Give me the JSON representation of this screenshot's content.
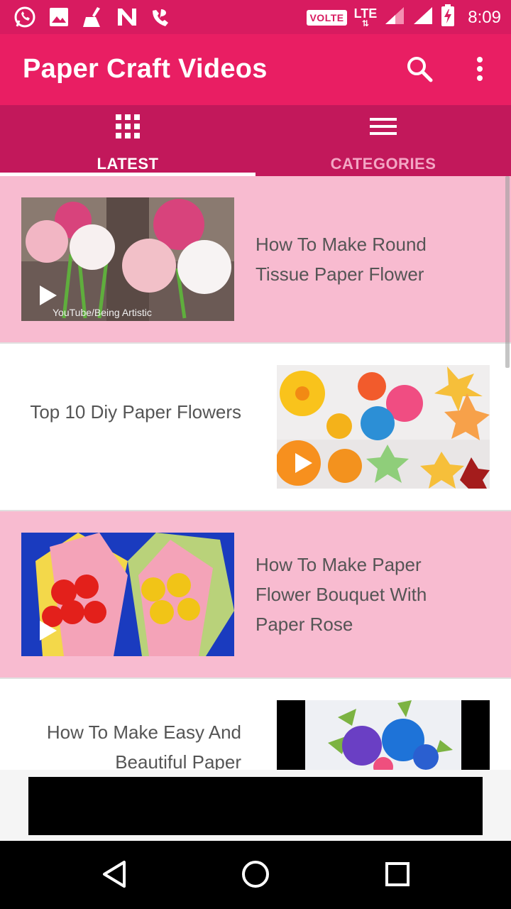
{
  "status_bar": {
    "volte": "VOLTE",
    "network": "LTE",
    "time": "8:09",
    "left_icons": [
      "whatsapp-icon",
      "image-icon",
      "cleaner-icon",
      "n-icon",
      "missed-call-icon"
    ]
  },
  "app_bar": {
    "title": "Paper Craft Videos",
    "search_icon": "search-icon",
    "more_icon": "more-vert-icon"
  },
  "tabs": [
    {
      "label": "LATEST",
      "icon": "grid-icon",
      "active": true
    },
    {
      "label": "CATEGORIES",
      "icon": "list-icon",
      "active": false
    }
  ],
  "videos": [
    {
      "title": "How To Make Round Tissue Paper Flower",
      "watermark": "YouTube/Being Artistic"
    },
    {
      "title": "Top 10 Diy Paper Flowers"
    },
    {
      "title": "How To Make Paper Flower Bouquet With Paper Rose"
    },
    {
      "title": "How To Make Easy And Beautiful Paper"
    }
  ],
  "colors": {
    "status_bar": "#d81b60",
    "app_bar": "#e91e63",
    "tab_bar": "#c2185b",
    "row_pink": "#f8bbd0",
    "row_white": "#ffffff",
    "title_text": "#555555"
  },
  "nav_bar": {
    "back_icon": "back-triangle-icon",
    "home_icon": "home-circle-icon",
    "recents_icon": "recents-square-icon"
  }
}
